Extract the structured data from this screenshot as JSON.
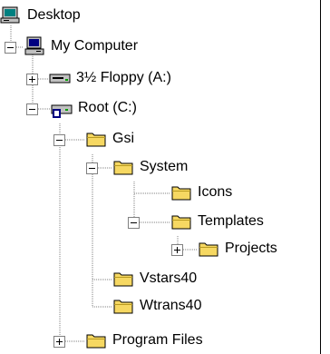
{
  "tree": {
    "items": [
      {
        "label": "Desktop",
        "icon": "desktop-icon"
      },
      {
        "label": "My Computer",
        "icon": "computer-icon",
        "expander": "minus"
      },
      {
        "label": "3½ Floppy (A:)",
        "icon": "floppy-drive-icon",
        "expander": "plus"
      },
      {
        "label": "Root (C:)",
        "icon": "hard-drive-icon",
        "expander": "minus"
      },
      {
        "label": "Gsi",
        "icon": "folder-icon",
        "expander": "minus"
      },
      {
        "label": "System",
        "icon": "folder-icon",
        "expander": "minus"
      },
      {
        "label": "Icons",
        "icon": "folder-icon"
      },
      {
        "label": "Templates",
        "icon": "folder-icon",
        "expander": "minus"
      },
      {
        "label": "Projects",
        "icon": "folder-icon",
        "expander": "plus"
      },
      {
        "label": "Vstars40",
        "icon": "folder-icon"
      },
      {
        "label": "Wtrans40",
        "icon": "folder-icon"
      },
      {
        "label": "Program Files",
        "icon": "folder-icon",
        "expander": "plus"
      }
    ]
  },
  "colors": {
    "folder": "#f6d862",
    "folder_shadow": "#b89a1f",
    "tree_lines": "#808080",
    "background": "#ffffff"
  }
}
